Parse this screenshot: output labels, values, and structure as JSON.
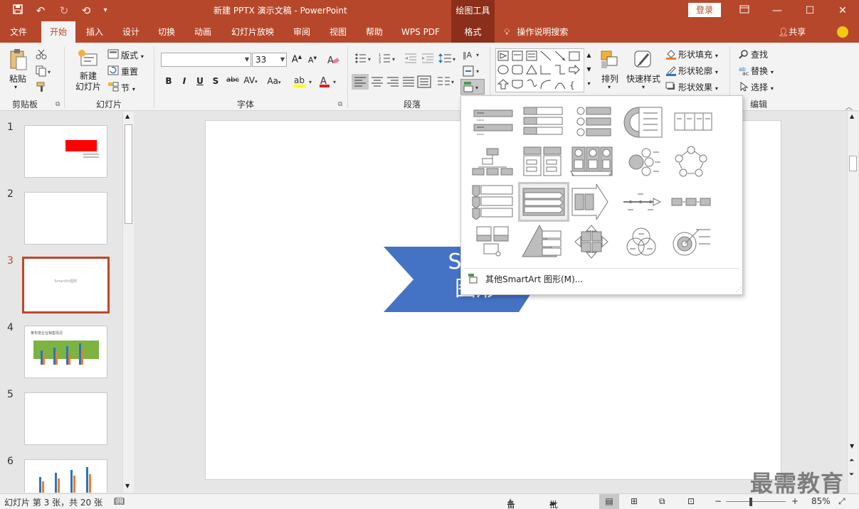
{
  "titlebar": {
    "doc_title": "新建 PPTX 演示文稿  -  PowerPoint",
    "context_tab": "绘图工具",
    "login": "登录"
  },
  "tabs": [
    "文件",
    "开始",
    "插入",
    "设计",
    "切换",
    "动画",
    "幻灯片放映",
    "审阅",
    "视图",
    "帮助",
    "WPS PDF",
    "格式"
  ],
  "active_tab": "开始",
  "tell_me": "操作说明搜索",
  "share": "共享",
  "ribbon": {
    "clipboard": {
      "paste": "粘贴",
      "label": "剪贴板"
    },
    "slides": {
      "new_slide": "新建\n幻灯片",
      "layout": "版式",
      "reset": "重置",
      "section": "节",
      "label": "幻灯片"
    },
    "font": {
      "font_name": "",
      "font_size": "33",
      "label": "字体"
    },
    "paragraph": {
      "label": "段落"
    },
    "drawing": {
      "arrange": "排列",
      "quick_styles": "快速样式",
      "shape_fill": "形状填充",
      "shape_outline": "形状轮廓",
      "shape_effect": "形状效果"
    },
    "editing": {
      "find": "查找",
      "replace": "替换",
      "select": "选择",
      "label": "编辑"
    }
  },
  "slides": [
    {
      "num": "1"
    },
    {
      "num": "2"
    },
    {
      "num": "3",
      "caption": "SmartArt图形"
    },
    {
      "num": "4",
      "caption": "某年度企业销售情况"
    },
    {
      "num": "5"
    },
    {
      "num": "6"
    }
  ],
  "current_slide": "3",
  "slide_shape_text": {
    "line1": "Smar",
    "line2": "图形"
  },
  "gallery": {
    "more": "其他SmartArt 图形(M)..."
  },
  "status": {
    "slide_info": "幻灯片 第 3 张，共 20 张",
    "notes": "备注",
    "comments": "批注",
    "zoom": "85%"
  },
  "watermark": "最需教育",
  "colors": {
    "accent": "#b7472a",
    "shape": "#4472c4"
  }
}
